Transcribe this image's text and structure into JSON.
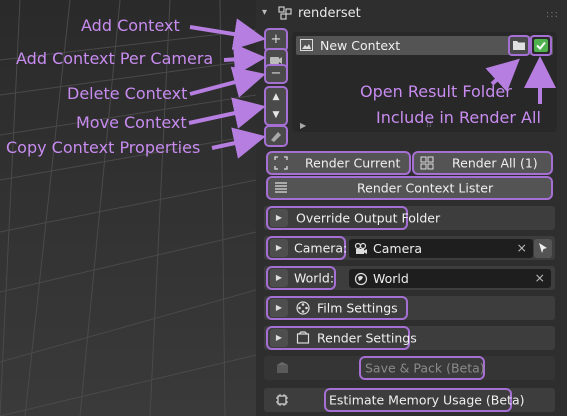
{
  "panel": {
    "title": "renderset"
  },
  "list": {
    "items": [
      {
        "label": "New Context"
      }
    ]
  },
  "annotations": {
    "add_context": "Add Context",
    "add_context_per_camera": "Add Context Per Camera",
    "delete_context": "Delete Context",
    "move_context": "Move Context",
    "copy_context_properties": "Copy Context Properties",
    "open_result_folder": "Open Result Folder",
    "include_in_render_all": "Include in Render All"
  },
  "buttons": {
    "render_current": "Render Current",
    "render_all": "Render All (1)",
    "render_context_lister": "Render Context Lister",
    "override_output_folder": "Override Output Folder",
    "camera_label": "Camera:",
    "camera_value": "Camera",
    "world_label": "World:",
    "world_value": "World",
    "film_settings": "Film Settings",
    "render_settings": "Render Settings",
    "save_pack": "Save & Pack (Beta)",
    "estimate_memory": "Estimate Memory Usage (Beta)"
  },
  "colors": {
    "annotation": "#c88cf0",
    "highlight": "#a56fd4",
    "checkbox": "#4fb24f"
  },
  "icons": {
    "header": "renderset-icon",
    "context": "image-icon",
    "folder": "folder-icon",
    "checkbox": "checkbox-checked-icon",
    "camera": "camera-icon",
    "world": "world-icon",
    "film": "film-reel-icon",
    "render": "render-settings-icon",
    "memory": "memory-chip-icon"
  }
}
